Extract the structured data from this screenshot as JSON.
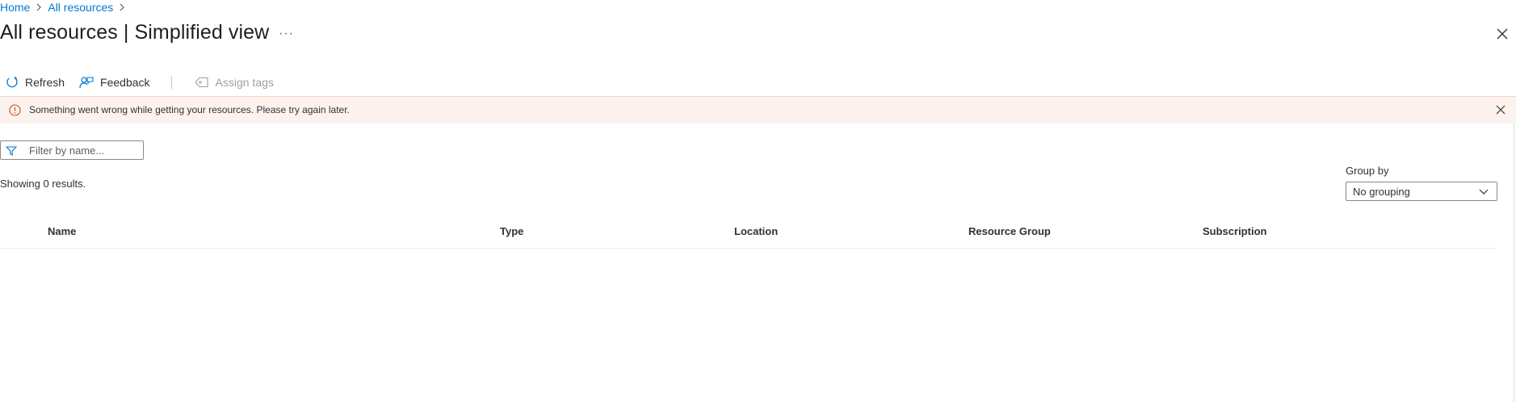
{
  "breadcrumb": {
    "home": "Home",
    "all_resources": "All resources"
  },
  "page": {
    "title": "All resources | Simplified view",
    "more_label": "···"
  },
  "toolbar": {
    "refresh": "Refresh",
    "feedback": "Feedback",
    "assign_tags": "Assign tags"
  },
  "banner": {
    "message": "Something went wrong while getting your resources. Please try again later."
  },
  "filter": {
    "placeholder": "Filter by name...",
    "value": ""
  },
  "results": {
    "summary": "Showing 0 results."
  },
  "group_by": {
    "label": "Group by",
    "selected": "No grouping"
  },
  "table": {
    "columns": [
      "Name",
      "Type",
      "Location",
      "Resource Group",
      "Subscription"
    ],
    "rows": []
  },
  "colors": {
    "accent": "#0078d4",
    "banner_bg": "#fdf3ee",
    "warning_icon": "#c8501b"
  },
  "icons": {
    "refresh": "refresh-icon",
    "feedback": "feedback-icon",
    "assign_tags": "tag-icon",
    "banner": "info-icon",
    "filter": "filter-icon",
    "close": "close-icon",
    "dropdown": "chevron-down-icon"
  }
}
